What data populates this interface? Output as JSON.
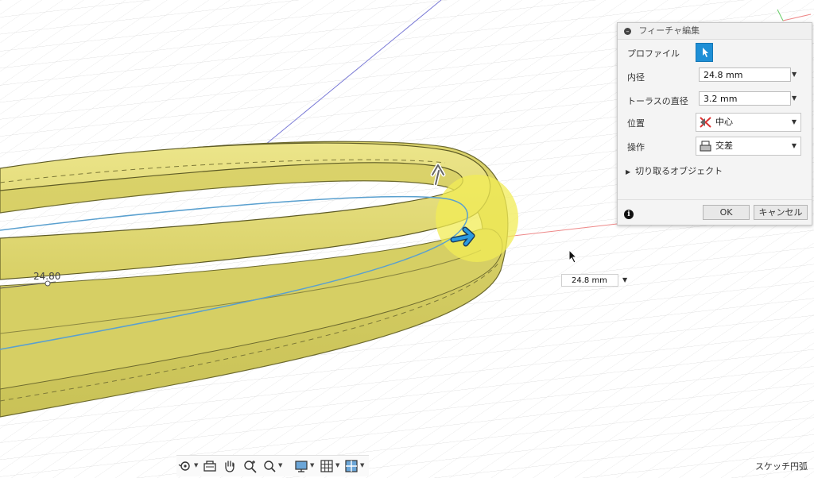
{
  "panel": {
    "title": "フィーチャ編集",
    "rows": {
      "profile": {
        "label": "プロファイル"
      },
      "inner_diameter": {
        "label": "内径",
        "value": "24.8 mm"
      },
      "torus_diameter": {
        "label": "トーラスの直径",
        "value": "3.2 mm"
      },
      "position": {
        "label": "位置",
        "value": "中心"
      },
      "operation": {
        "label": "操作",
        "value": "交差"
      }
    },
    "expander": "切り取るオブジェクト",
    "ok_label": "OK",
    "cancel_label": "キャンセル"
  },
  "viewport": {
    "dimension_input": "24.8 mm",
    "dimension_label": "24.80"
  },
  "status_text": "スケッチ円弧",
  "colors": {
    "body": "#e6e07a",
    "accent_blue": "#1e8fd6",
    "grid": "#dcdcdc",
    "axis_red": "#e35b5b",
    "axis_blue": "#7070d0"
  },
  "icons": {
    "profile": "select-arrow-icon",
    "position": "center-position-icon",
    "operation": "intersect-icon"
  }
}
